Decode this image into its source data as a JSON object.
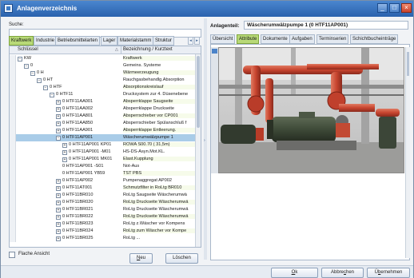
{
  "window": {
    "title": "Anlagenverzeichnis"
  },
  "left": {
    "search_label": "Suche:",
    "search_value": "",
    "tabs": [
      "Kraftwerk",
      "Industrie",
      "Betriebsmittelarten",
      "Lager",
      "Materialstamm",
      "Struktur"
    ],
    "columns": {
      "key": "Schlüssel",
      "desc": "Bezeichnung / Kurztext"
    },
    "rows": [
      {
        "key": "KW",
        "desc": "Kraftwerk",
        "exp": "−",
        "indent": 0
      },
      {
        "key": "0",
        "desc": "Gemeins. Systeme",
        "exp": "−",
        "indent": 1
      },
      {
        "key": "0 H",
        "desc": "Wärmeerzeugung",
        "exp": "−",
        "indent": 2
      },
      {
        "key": "0 HT",
        "desc": "Rauchgasbehandlg.Absorption",
        "exp": "−",
        "indent": 3
      },
      {
        "key": "0 HTF",
        "desc": "Absorptionskreislauf",
        "exp": "−",
        "indent": 4
      },
      {
        "key": "0 HTF11",
        "desc": "Drucksystem zur 4. Düsenebene",
        "exp": "−",
        "indent": 5
      },
      {
        "key": "0 HTF11AA001",
        "desc": "Absperrklappe Saugseite",
        "exp": "+",
        "indent": 6
      },
      {
        "key": "0 HTF11AA002",
        "desc": "Absperrklappe Druckseite",
        "exp": "+",
        "indent": 6
      },
      {
        "key": "0 HTF11AA801",
        "desc": "Absperrschieber vor CP001",
        "exp": "+",
        "indent": 6
      },
      {
        "key": "0 HTF11AA850",
        "desc": "Absperrschieber Spülanschluß f",
        "exp": "+",
        "indent": 6
      },
      {
        "key": "0 HTF11AA901",
        "desc": "Absperrklappe Entleerung.",
        "exp": "+",
        "indent": 6
      },
      {
        "key": "0 HTF11AP001",
        "desc": "Wäscherumwälzpumpe 1",
        "exp": "−",
        "indent": 6,
        "selected": true
      },
      {
        "key": "0 HTF11AP001 KP01",
        "desc": "ROWA    S00.70 ( 31,5m)",
        "exp": "+",
        "indent": 7
      },
      {
        "key": "0 HTF11AP001 -M01",
        "desc": "HS-DS-Asyn.Mot.KL.",
        "exp": "+",
        "indent": 7
      },
      {
        "key": "0 HTF11AP001 MK01",
        "desc": "Elast.Kupplung",
        "exp": "+",
        "indent": 7
      },
      {
        "key": "0 HTF11AP001 -S01",
        "desc": "Not-Aus",
        "exp": "",
        "indent": 7
      },
      {
        "key": "0 HTF11AP001 YB59",
        "desc": "TST PBS",
        "exp": "",
        "indent": 7
      },
      {
        "key": "0 HTF11AP002",
        "desc": "Pumpenaggregat AP002",
        "exp": "+",
        "indent": 6
      },
      {
        "key": "0 HTF11AT001",
        "desc": "Schmutzfilter in RoLtg BR010",
        "exp": "+",
        "indent": 6
      },
      {
        "key": "0 HTF11BR010",
        "desc": "RoLtg Saugseite Wäscherumwä",
        "exp": "+",
        "indent": 6
      },
      {
        "key": "0 HTF11BR020",
        "desc": "RoLtg Druckseite Wäscherumwä",
        "exp": "+",
        "indent": 6
      },
      {
        "key": "0 HTF11BR021",
        "desc": "RoLtg Druckseite Wäscherumwä",
        "exp": "+",
        "indent": 6
      },
      {
        "key": "0 HTF11BR022",
        "desc": "RoLtg Druckseite Wäscherumwä",
        "exp": "+",
        "indent": 6
      },
      {
        "key": "0 HTF11BR023",
        "desc": "RoLtg z.Wäscher vor Kompens",
        "exp": "+",
        "indent": 6
      },
      {
        "key": "0 HTF11BR024",
        "desc": "RoLtg zum Wäscher vor Kompe",
        "exp": "+",
        "indent": 6
      },
      {
        "key": "0 HTF11BR025",
        "desc": "RoLtg ...",
        "exp": "+",
        "indent": 6
      }
    ],
    "flat_view_label": "Flache Ansicht",
    "new_label_pre": "",
    "new_label_ul": "N",
    "new_label_post": "eu",
    "delete_label": "Löschen"
  },
  "right": {
    "anlagenteil_label": "Anlagenteil:",
    "anlagenteil_value": "Wäscherumwälzpumpe 1 (0 HTF11AP001)",
    "tabs": [
      "Übersicht",
      "Attribute",
      "Dokumente",
      "Aufgaben",
      "Terminserien",
      "Schichtbucheinträge"
    ],
    "active_tab": "Attribute"
  },
  "footer": {
    "ok_label_ul": "O",
    "ok_label_post": "k",
    "cancel_label_pre": "Abbre",
    "cancel_label_ul": "c",
    "cancel_label_post": "hen",
    "apply_label_pre": "Ü",
    "apply_label_ul": "b",
    "apply_label_post": "ernehmen"
  },
  "colors": {
    "accent": "#2a62ad",
    "tab_active": "#b8d977",
    "selection": "#a9cce8"
  }
}
